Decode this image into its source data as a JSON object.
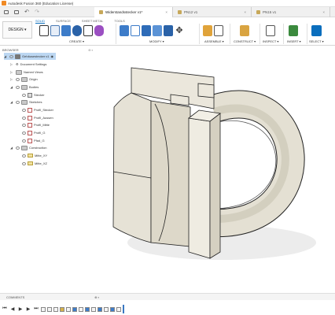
{
  "window": {
    "title": "Autodesk Fusion 360 (Education License)"
  },
  "qat": {
    "icons": [
      "grid-menu-icon",
      "save-icon",
      "undo-icon",
      "redo-icon"
    ]
  },
  "doc_tabs": [
    {
      "label": "Widerstandsstecker v1*",
      "active": true
    },
    {
      "label": "PN12 v1",
      "active": false
    },
    {
      "label": "PN15 v1",
      "active": false
    }
  ],
  "ribbon": {
    "workspace": "DESIGN ▾",
    "tabs": [
      "SOLID",
      "SURFACE",
      "SHEET METAL",
      "TOOLS"
    ],
    "active_tab": "SOLID",
    "groups": [
      "CREATE ▾",
      "MODIFY ▾",
      "ASSEMBLE ▾",
      "CONSTRUCT ▾",
      "INSPECT ▾",
      "INSERT ▾",
      "SELECT ▾"
    ]
  },
  "browser": {
    "title": "BROWSER",
    "nodes": [
      {
        "label": "Gehäusestecker v1",
        "depth": 0,
        "icon": "component",
        "expanded": true,
        "highlight": true
      },
      {
        "label": "Document Settings",
        "depth": 1,
        "icon": "settings",
        "expanded": false
      },
      {
        "label": "Named Views",
        "depth": 1,
        "icon": "folder",
        "expanded": false
      },
      {
        "label": "Origin",
        "depth": 1,
        "icon": "folder",
        "expanded": false
      },
      {
        "label": "Bodies",
        "depth": 1,
        "icon": "folder",
        "expanded": true
      },
      {
        "label": "Stecker",
        "depth": 2,
        "icon": "body"
      },
      {
        "label": "Sketches",
        "depth": 1,
        "icon": "folder",
        "expanded": true
      },
      {
        "label": "Profil_Stecker",
        "depth": 2,
        "icon": "sketch"
      },
      {
        "label": "Profil_Aussen",
        "depth": 2,
        "icon": "sketch"
      },
      {
        "label": "Profil_Mitte",
        "depth": 2,
        "icon": "sketch"
      },
      {
        "label": "Profil_G",
        "depth": 2,
        "icon": "sketch"
      },
      {
        "label": "Pfad_G",
        "depth": 2,
        "icon": "sketch"
      },
      {
        "label": "Construction",
        "depth": 1,
        "icon": "folder",
        "expanded": true
      },
      {
        "label": "Mitte_XY",
        "depth": 2,
        "icon": "plane"
      },
      {
        "label": "Mitte_XZ",
        "depth": 2,
        "icon": "plane"
      }
    ]
  },
  "comments": {
    "label": "COMMENTS"
  },
  "timeline": {
    "controls": [
      "⏮",
      "◀",
      "▶",
      "▶",
      "⏭"
    ],
    "feature_count": 13
  },
  "colors": {
    "accent": "#0a6ebd",
    "model_face": "#e9e5d9",
    "model_shade": "#cfcabb",
    "model_edge": "#222222",
    "selection": "#bcd7f2"
  }
}
